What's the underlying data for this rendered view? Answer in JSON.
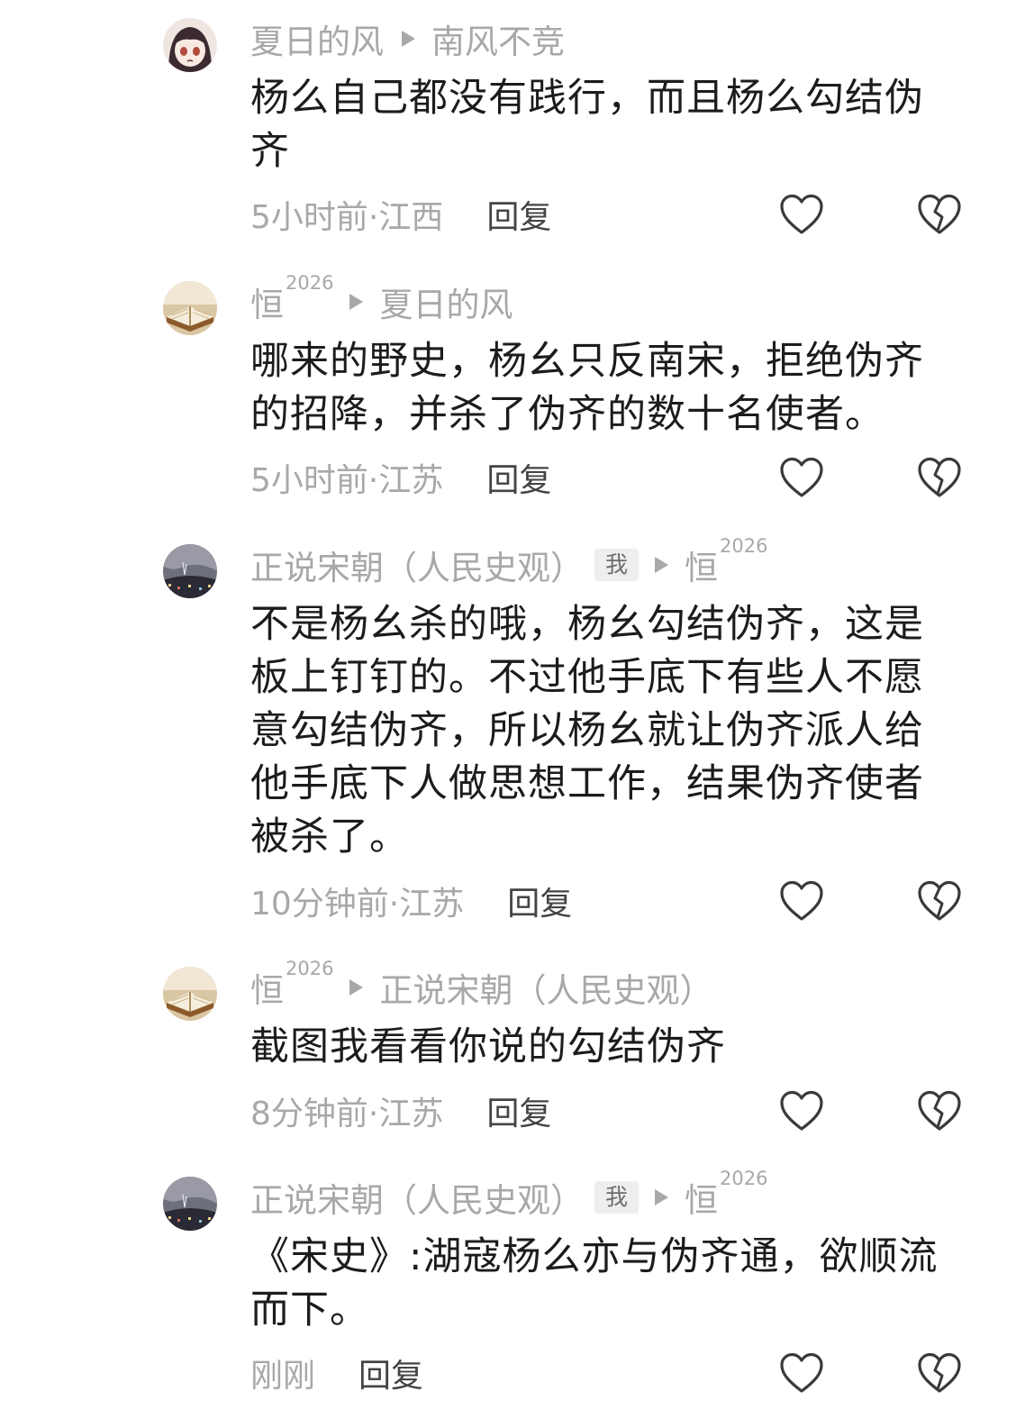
{
  "comments": [
    {
      "avatar": "anime-girl-avatar",
      "author": "夏日的风",
      "author_sup": "",
      "is_me": false,
      "reply_to": "南风不竞",
      "reply_to_sup": "",
      "text": "杨么自己都没有践行，而且杨么勾结伪齐",
      "time_location": "5小时前·江西",
      "reply_label": "回复"
    },
    {
      "avatar": "book-avatar",
      "author": "恒",
      "author_sup": "2026",
      "is_me": false,
      "reply_to": "夏日的风",
      "reply_to_sup": "",
      "text": "哪来的野史，杨幺只反南宋，拒绝伪齐的招降，并杀了伪齐的数十名使者。",
      "time_location": "5小时前·江苏",
      "reply_label": "回复"
    },
    {
      "avatar": "city-night-avatar",
      "author": "正说宋朝（人民史观）",
      "author_sup": "",
      "is_me": true,
      "me_label": "我",
      "reply_to": "恒",
      "reply_to_sup": "2026",
      "text": "不是杨幺杀的哦，杨幺勾结伪齐，这是板上钉钉的。不过他手底下有些人不愿意勾结伪齐，所以杨幺就让伪齐派人给他手底下人做思想工作，结果伪齐使者被杀了。",
      "time_location": "10分钟前·江苏",
      "reply_label": "回复"
    },
    {
      "avatar": "book-avatar",
      "author": "恒",
      "author_sup": "2026",
      "is_me": false,
      "reply_to": "正说宋朝（人民史观）",
      "reply_to_sup": "",
      "text": "截图我看看你说的勾结伪齐",
      "time_location": "8分钟前·江苏",
      "reply_label": "回复"
    },
    {
      "avatar": "city-night-avatar",
      "author": "正说宋朝（人民史观）",
      "author_sup": "",
      "is_me": true,
      "me_label": "我",
      "reply_to": "恒",
      "reply_to_sup": "2026",
      "text": "《宋史》:湖寇杨么亦与伪齐通，欲顺流而下。",
      "time_location": "刚刚",
      "reply_label": "回复"
    }
  ],
  "icons": {
    "like": "heart-outline-icon",
    "dislike": "broken-heart-outline-icon",
    "reply_arrow": "triangle-right-icon"
  },
  "colors": {
    "meta_gray": "#a8a8a8",
    "text": "#1c1c1c",
    "reply": "#444444",
    "badge_bg": "#eeeeee"
  }
}
